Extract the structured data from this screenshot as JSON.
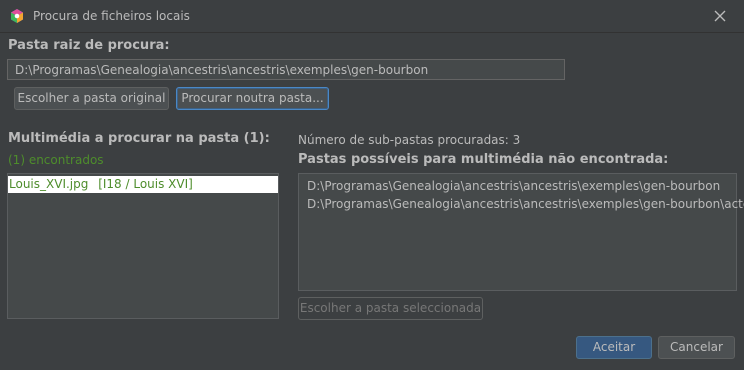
{
  "window": {
    "title": "Procura de ficheiros locais",
    "icon": "ancestris-app-icon",
    "close_icon": "close-icon"
  },
  "root_section": {
    "label": "Pasta raiz de procura:",
    "path_value": "D:\\Programas\\Genealogia\\ancestris\\ancestris\\exemples\\gen-bourbon",
    "choose_original_button": "Escolher a pasta original",
    "search_other_button": "Procurar noutra pasta..."
  },
  "media_section": {
    "label": "Multimédia a procurar na pasta (1):",
    "found_label": "(1) encontrados",
    "items": [
      {
        "file": "Louis_XVI.jpg",
        "ref": "[I18 / Louis XVI]",
        "selected": true
      }
    ]
  },
  "folders_section": {
    "subfolders_count_text": "Número de sub-pastas procuradas: 3",
    "label": "Pastas possíveis para multimédia não encontrada:",
    "items": [
      "D:\\Programas\\Genealogia\\ancestris\\ancestris\\exemples\\gen-bourbon",
      "D:\\Programas\\Genealogia\\ancestris\\ancestris\\exemples\\gen-bourbon\\actes"
    ],
    "choose_selected_button": "Escolher a pasta seleccionada"
  },
  "footer": {
    "accept_button": "Aceitar",
    "cancel_button": "Cancelar"
  },
  "colors": {
    "background": "#3c3f41",
    "found_text": "#4e8d2c",
    "primary_button": "#365880",
    "focus_border": "#4a88c7"
  }
}
